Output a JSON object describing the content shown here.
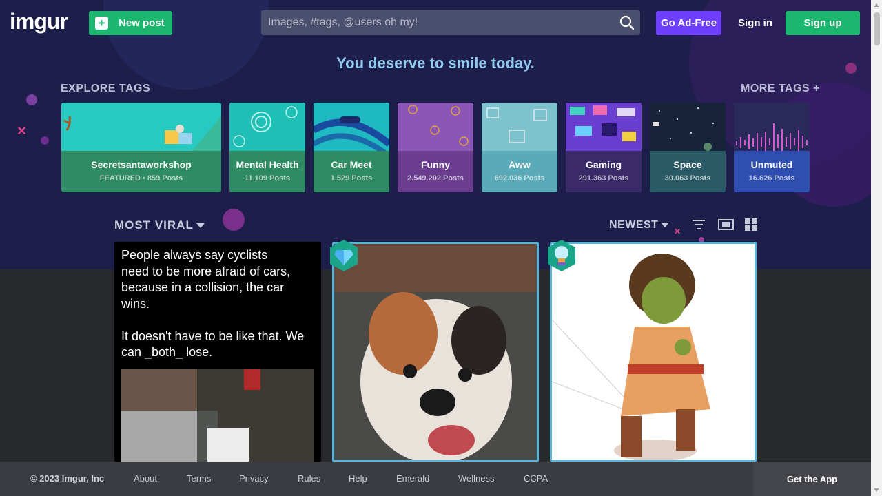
{
  "header": {
    "logo": "imgur",
    "new_post": "New post",
    "search_placeholder": "Images, #tags, @users oh my!",
    "ad_free": "Go Ad-Free",
    "sign_in": "Sign in",
    "sign_up": "Sign up"
  },
  "tagline": "You deserve to smile today.",
  "explore": {
    "title": "EXPLORE TAGS",
    "more": "MORE TAGS +",
    "tags": [
      {
        "name": "Secretsantaworkshop",
        "count": "FEATURED • 859 Posts",
        "color": "#2e8b63",
        "img": "#27c9c0"
      },
      {
        "name": "Mental Health",
        "count": "11.109 Posts",
        "color": "#2e8b63",
        "img": "#1fbfb5"
      },
      {
        "name": "Car Meet",
        "count": "1.529 Posts",
        "color": "#2e8b63",
        "img": "#1fb9c2"
      },
      {
        "name": "Funny",
        "count": "2.549.202 Posts",
        "color": "#6b3d8f",
        "img": "#8a56b8"
      },
      {
        "name": "Aww",
        "count": "692.036 Posts",
        "color": "#5aaab8",
        "img": "#7dc2cc"
      },
      {
        "name": "Gaming",
        "count": "291.363 Posts",
        "color": "#3a2a6a",
        "img": "#6a3fd0"
      },
      {
        "name": "Space",
        "count": "30.063 Posts",
        "color": "#2a5a66",
        "img": "#17233a"
      },
      {
        "name": "Unmuted",
        "count": "16.626 Posts",
        "color": "#2f4fb0",
        "img": "#2a2a5a"
      }
    ]
  },
  "feed": {
    "sort": "MOST VIRAL",
    "order": "NEWEST",
    "post1_text": "People always say cyclists\nneed to be more afraid of cars,\nbecause in a collision, the car\nwins.\n\nIt doesn't have to be like that. We\ncan _both_ lose."
  },
  "footer": {
    "copyright": "© 2023 Imgur, Inc",
    "links": [
      "About",
      "Terms",
      "Privacy",
      "Rules",
      "Help",
      "Emerald",
      "Wellness",
      "CCPA"
    ],
    "get_app": "Get the App"
  }
}
